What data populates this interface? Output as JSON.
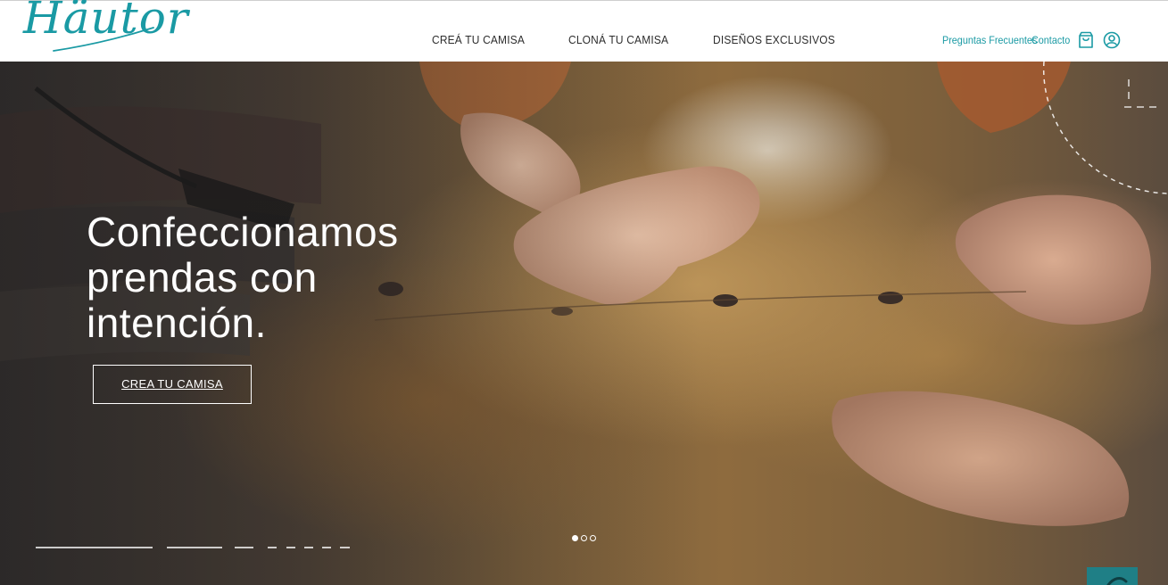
{
  "brand": {
    "logo_text": "Häutor",
    "accent_color": "#1a9aa4"
  },
  "main_nav": {
    "items": [
      {
        "label": "CREÁ TU CAMISA"
      },
      {
        "label": "CLONÁ TU CAMISA"
      },
      {
        "label": "DISEÑOS EXCLUSIVOS"
      }
    ]
  },
  "utility_nav": {
    "faq_label": "Preguntas Frecuentes",
    "contact_label": "Contacto",
    "bag_icon": "shopping-bag-icon",
    "user_icon": "user-circle-icon"
  },
  "hero": {
    "title_lines": [
      "Confeccionamos",
      "prendas con",
      "intención."
    ],
    "cta_label": "CREA TU CAMISA",
    "slides": {
      "count": 3,
      "active_index": 0
    }
  },
  "floating": {
    "chat_icon": "chat-icon"
  }
}
